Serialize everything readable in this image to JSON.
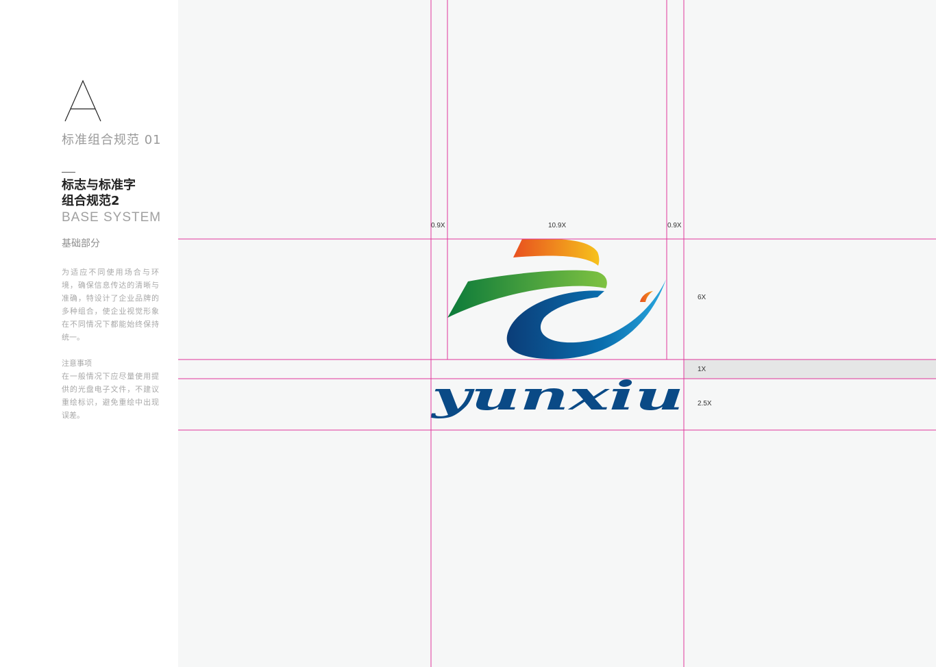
{
  "sidebar": {
    "letter": "A",
    "section_title": "标准组合规范 01",
    "heading_line1": "标志与标准字",
    "heading_line2": "组合规范2",
    "en_title": "BASE SYSTEM",
    "part": "基础部分",
    "description": "为适应不同使用场合与环境，确保信息传达的清晰与准确，特设计了企业品牌的多种组合，使企业视觉形象在不同情况下都能始终保持统一。",
    "notes_title": "注意事项",
    "notes_body": "在一般情况下应尽量使用提供的光盘电子文件，不建议重绘标识，避免重绘中出现误差。"
  },
  "diagram": {
    "dims": {
      "left_margin": "0.9X",
      "logo_width": "10.9X",
      "right_margin": "0.9X",
      "logo_height": "6X",
      "gap": "1X",
      "wordmark_height": "2.5X"
    },
    "wordmark": "yunxiu",
    "colors": {
      "guide": "#e0359b",
      "gap_band": "#e5e6e6",
      "brand_blue": "#0a4a86",
      "brand_green": "#3aa63d",
      "brand_orange": "#f39a1e"
    }
  }
}
